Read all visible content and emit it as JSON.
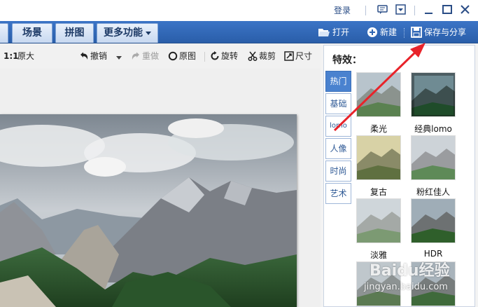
{
  "titlebar": {
    "login": "登录",
    "icons": [
      "chat-icon",
      "dropdown-box-icon",
      "minimize-icon",
      "maximize-icon",
      "close-icon"
    ]
  },
  "tabs": [
    {
      "label": ""
    },
    {
      "label": "场景"
    },
    {
      "label": "拼图"
    },
    {
      "label": "更多功能"
    }
  ],
  "nav": {
    "open": "打开",
    "new": "新建",
    "save_share": "保存与分享"
  },
  "edit_bar": {
    "ratio": "1:1",
    "original_size": "原大",
    "undo": "撤销",
    "redo": "重做",
    "original_image": "原图",
    "rotate": "旋转",
    "crop": "裁剪",
    "size": "尺寸"
  },
  "panel": {
    "title": "特效：",
    "categories": [
      "热门",
      "基础",
      "lomo",
      "人像",
      "时尚",
      "艺术"
    ],
    "active_category": "热门",
    "effects": [
      "柔光",
      "经典lomo",
      "复古",
      "粉红佳人",
      "淡雅",
      "HDR"
    ]
  },
  "watermark": {
    "brand": "Baidu经验",
    "url": "jingyan.baidu.com"
  },
  "colors": {
    "toolbar_blue": "#2f66b3",
    "accent_red": "#e8232a"
  }
}
